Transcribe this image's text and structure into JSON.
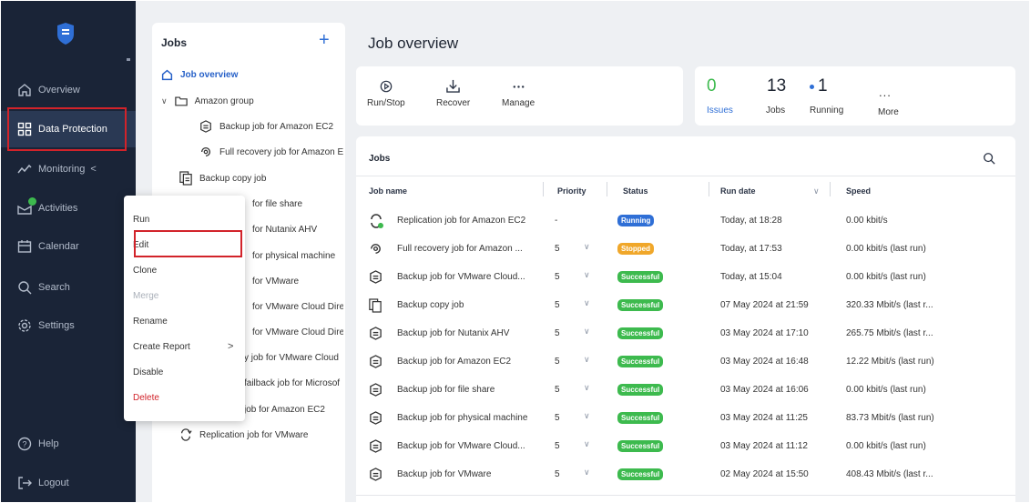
{
  "sidebar": {
    "items": [
      {
        "label": "Overview",
        "icon": "home-icon"
      },
      {
        "label": "Data Protection",
        "icon": "grid-icon"
      },
      {
        "label": "Monitoring",
        "icon": "chart-line-icon",
        "chevron": "<"
      },
      {
        "label": "Activities",
        "icon": "activities-icon"
      },
      {
        "label": "Calendar",
        "icon": "calendar-icon"
      },
      {
        "label": "Search",
        "icon": "search-icon"
      },
      {
        "label": "Settings",
        "icon": "gear-icon"
      }
    ],
    "help_label": "Help",
    "logout_label": "Logout"
  },
  "tree": {
    "title": "Jobs",
    "add_label": "+",
    "items": [
      {
        "label": "Job overview"
      },
      {
        "label": "Amazon group"
      },
      {
        "label": "Backup job for Amazon EC2"
      },
      {
        "label": "Full recovery job for Amazon E"
      },
      {
        "label": "Backup copy job"
      },
      {
        "label": "for file share"
      },
      {
        "label": "for Nutanix AHV"
      },
      {
        "label": "for physical machine"
      },
      {
        "label": "for VMware"
      },
      {
        "label": "for VMware Cloud Direc"
      },
      {
        "label": "for VMware Cloud Direc"
      },
      {
        "label": "y job for VMware Cloud"
      },
      {
        "label": "failback job for Microsof"
      },
      {
        "label": "job for Amazon EC2"
      },
      {
        "label": "Replication job for VMware"
      }
    ]
  },
  "context_menu": {
    "items": [
      "Run",
      "Edit",
      "Clone",
      "Merge",
      "Rename",
      "Create Report",
      "Disable",
      "Delete"
    ],
    "submenu_arrow": ">"
  },
  "main": {
    "title": "Job overview",
    "toolbar": [
      {
        "label": "Run/Stop",
        "icon": "play-icon"
      },
      {
        "label": "Recover",
        "icon": "download-icon"
      },
      {
        "label": "Manage",
        "icon": "more-icon"
      }
    ],
    "stats": {
      "issues_value": "0",
      "issues_label": "Issues",
      "jobs_value": "13",
      "jobs_label": "Jobs",
      "running_value": "1",
      "running_label": "Running",
      "more_label": "More",
      "more_dots": "..."
    },
    "colors": {
      "accent": "#2f6fd6",
      "green": "#3dba4e",
      "orange": "#f0a72a",
      "sidebar": "#1a2437",
      "highlight": "#d2232a"
    }
  },
  "table": {
    "title": "Jobs",
    "columns": [
      "Job name",
      "Priority",
      "Status",
      "Run date",
      "Speed"
    ],
    "rows": [
      {
        "name": "Replication job for Amazon EC2",
        "priority": "-",
        "status": "Running",
        "run_date": "Today, at 18:28",
        "speed": "0.00 kbit/s",
        "icon": "replication-icon"
      },
      {
        "name": "Full recovery job for Amazon ...",
        "priority": "5",
        "status": "Stopped",
        "run_date": "Today, at 17:53",
        "speed": "0.00 kbit/s (last run)",
        "icon": "recovery-icon"
      },
      {
        "name": "Backup job for VMware Cloud...",
        "priority": "5",
        "status": "Successful",
        "run_date": "Today, at 15:04",
        "speed": "0.00 kbit/s (last run)",
        "icon": "backup-icon"
      },
      {
        "name": "Backup copy job",
        "priority": "5",
        "status": "Successful",
        "run_date": "07 May 2024 at 21:59",
        "speed": "320.33 Mbit/s (last r...",
        "icon": "copy-icon"
      },
      {
        "name": "Backup job for Nutanix AHV",
        "priority": "5",
        "status": "Successful",
        "run_date": "03 May 2024 at 17:10",
        "speed": "265.75 Mbit/s (last r...",
        "icon": "backup-icon"
      },
      {
        "name": "Backup job for Amazon EC2",
        "priority": "5",
        "status": "Successful",
        "run_date": "03 May 2024 at 16:48",
        "speed": "12.22 Mbit/s (last run)",
        "icon": "backup-icon"
      },
      {
        "name": "Backup job for file share",
        "priority": "5",
        "status": "Successful",
        "run_date": "03 May 2024 at 16:06",
        "speed": "0.00 kbit/s (last run)",
        "icon": "backup-icon"
      },
      {
        "name": "Backup job for physical machine",
        "priority": "5",
        "status": "Successful",
        "run_date": "03 May 2024 at 11:25",
        "speed": "83.73 Mbit/s (last run)",
        "icon": "backup-icon"
      },
      {
        "name": "Backup job for VMware Cloud...",
        "priority": "5",
        "status": "Successful",
        "run_date": "03 May 2024 at 11:12",
        "speed": "0.00 kbit/s (last run)",
        "icon": "backup-icon"
      },
      {
        "name": "Backup job for VMware",
        "priority": "5",
        "status": "Successful",
        "run_date": "02 May 2024 at 15:50",
        "speed": "408.43 Mbit/s (last r...",
        "icon": "backup-icon"
      }
    ]
  }
}
